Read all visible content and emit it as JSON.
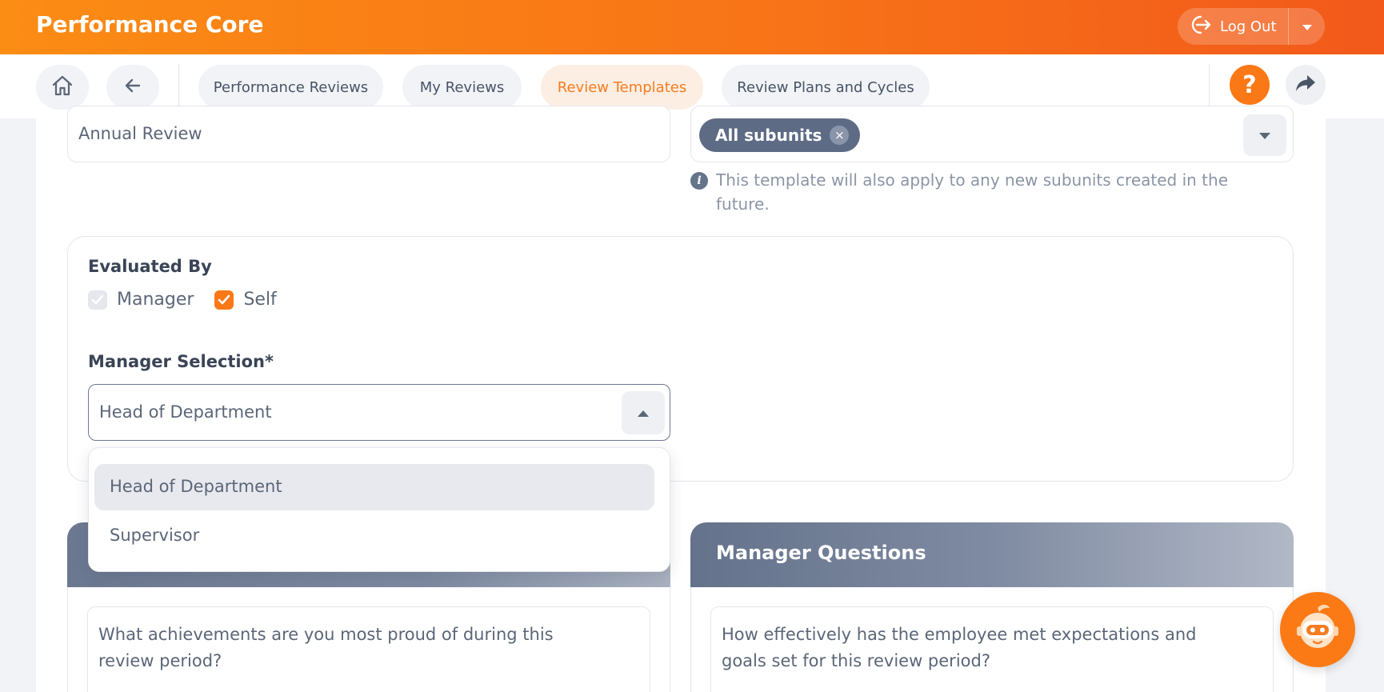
{
  "app": {
    "title": "Performance Core"
  },
  "header": {
    "logout_label": "Log Out"
  },
  "nav": {
    "tabs": [
      {
        "label": "Performance Reviews"
      },
      {
        "label": "My Reviews"
      },
      {
        "label": "Review Templates",
        "active": true
      },
      {
        "label": "Review Plans and Cycles"
      }
    ],
    "help_label": "?"
  },
  "form": {
    "template_name_value": "Annual Review",
    "subunits": {
      "chip_label": "All subunits",
      "remove_glyph": "×"
    },
    "subunit_hint": "This template will also apply to any new subunits created in the future.",
    "evaluated_by": {
      "label": "Evaluated By",
      "options": [
        {
          "label": "Manager",
          "checked": true,
          "disabled": true
        },
        {
          "label": "Self",
          "checked": true,
          "disabled": false
        }
      ]
    },
    "manager_selection": {
      "label": "Manager Selection*",
      "value": "Head of Department",
      "options": [
        "Head of Department",
        "Supervisor"
      ]
    }
  },
  "questions": {
    "self": {
      "first": "What achievements are you most proud of during this review period?"
    },
    "manager": {
      "title": "Manager Questions",
      "first": "How effectively has the employee met expectations and goals set for this review period?"
    }
  },
  "colors": {
    "accent": "#fb7817",
    "chip": "#5e6b85",
    "header_gradient_start": "#fb8c14",
    "header_gradient_end": "#f2591b"
  }
}
